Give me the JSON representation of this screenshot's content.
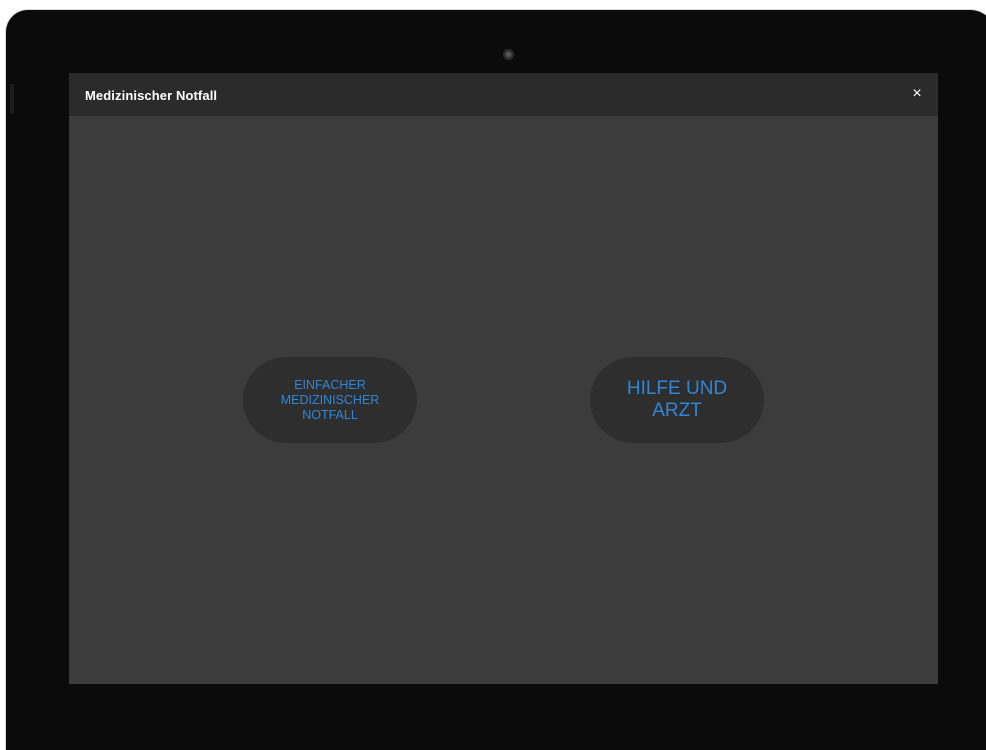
{
  "dialog": {
    "title": "Medizinischer Notfall",
    "close_label": "×"
  },
  "buttons": {
    "simple_emergency_label": "EINFACHER MEDIZINISCHER NOTFALL",
    "help_and_doctor_label": "HILFE UND ARZT"
  },
  "colors": {
    "accent": "#2f86d6",
    "screen_bg": "#3c3c3c",
    "titlebar_bg": "#2b2b2b",
    "button_bg": "#2e2e2e"
  },
  "icons": {
    "close": "close-icon"
  }
}
